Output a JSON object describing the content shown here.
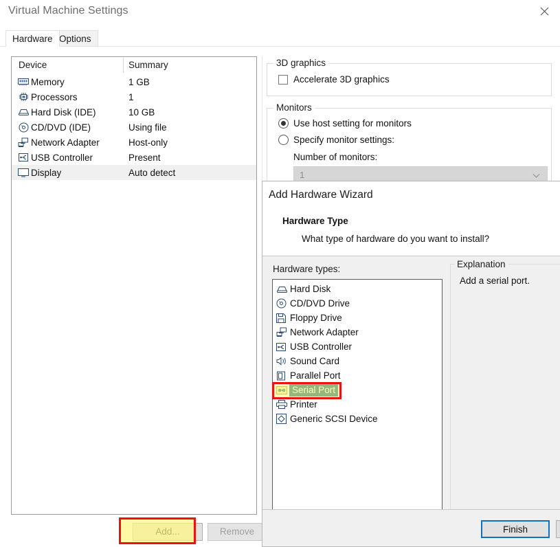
{
  "window": {
    "title": "Virtual Machine Settings",
    "close_icon": "close-icon"
  },
  "tabs": [
    {
      "label": "Hardware",
      "active": true
    },
    {
      "label": "Options",
      "active": false
    }
  ],
  "device_list": {
    "columns": [
      "Device",
      "Summary"
    ],
    "rows": [
      {
        "icon": "memory-icon",
        "device": "Memory",
        "summary": "1 GB",
        "selected": false
      },
      {
        "icon": "processor-icon",
        "device": "Processors",
        "summary": "1",
        "selected": false
      },
      {
        "icon": "hard-disk-icon",
        "device": "Hard Disk (IDE)",
        "summary": "10 GB",
        "selected": false
      },
      {
        "icon": "cd-dvd-icon",
        "device": "CD/DVD (IDE)",
        "summary": "Using file",
        "selected": false
      },
      {
        "icon": "network-adapter-icon",
        "device": "Network Adapter",
        "summary": "Host-only",
        "selected": false
      },
      {
        "icon": "usb-controller-icon",
        "device": "USB Controller",
        "summary": "Present",
        "selected": false
      },
      {
        "icon": "display-icon",
        "device": "Display",
        "summary": "Auto detect",
        "selected": true
      }
    ],
    "buttons": {
      "add": "Add...",
      "remove": "Remove"
    }
  },
  "settings_pane": {
    "graphics_group": {
      "title": "3D graphics",
      "accelerate_label": "Accelerate 3D graphics",
      "accelerate_checked": false
    },
    "monitors_group": {
      "title": "Monitors",
      "use_host_label": "Use host setting for monitors",
      "specify_label": "Specify monitor settings:",
      "selected": "use_host",
      "number_label": "Number of monitors:",
      "number_value": "1"
    }
  },
  "wizard": {
    "title": "Add Hardware Wizard",
    "heading": "Hardware Type",
    "subheading": "What type of hardware do you want to install?",
    "hardware_types_label": "Hardware types:",
    "hardware_types": [
      {
        "icon": "hard-disk-icon",
        "label": "Hard Disk",
        "selected": false
      },
      {
        "icon": "cd-dvd-icon",
        "label": "CD/DVD Drive",
        "selected": false
      },
      {
        "icon": "floppy-icon",
        "label": "Floppy Drive",
        "selected": false
      },
      {
        "icon": "network-adapter-icon",
        "label": "Network Adapter",
        "selected": false
      },
      {
        "icon": "usb-controller-icon",
        "label": "USB Controller",
        "selected": false
      },
      {
        "icon": "sound-card-icon",
        "label": "Sound Card",
        "selected": false
      },
      {
        "icon": "parallel-port-icon",
        "label": "Parallel Port",
        "selected": false
      },
      {
        "icon": "serial-port-icon",
        "label": "Serial Port",
        "selected": true
      },
      {
        "icon": "printer-icon",
        "label": "Printer",
        "selected": false
      },
      {
        "icon": "scsi-device-icon",
        "label": "Generic SCSI Device",
        "selected": false
      }
    ],
    "explanation": {
      "title": "Explanation",
      "text": "Add a serial port."
    },
    "buttons": {
      "finish": "Finish"
    }
  },
  "annotations": {
    "add_button_highlight": {
      "border_color": "#e81313",
      "fill_color": "#fff782"
    },
    "serial_port_highlight": {
      "border_color": "#e81313",
      "fill_color": "#fff782"
    },
    "selection_color": "#14697a",
    "focus_border_color": "#0a72c4"
  }
}
